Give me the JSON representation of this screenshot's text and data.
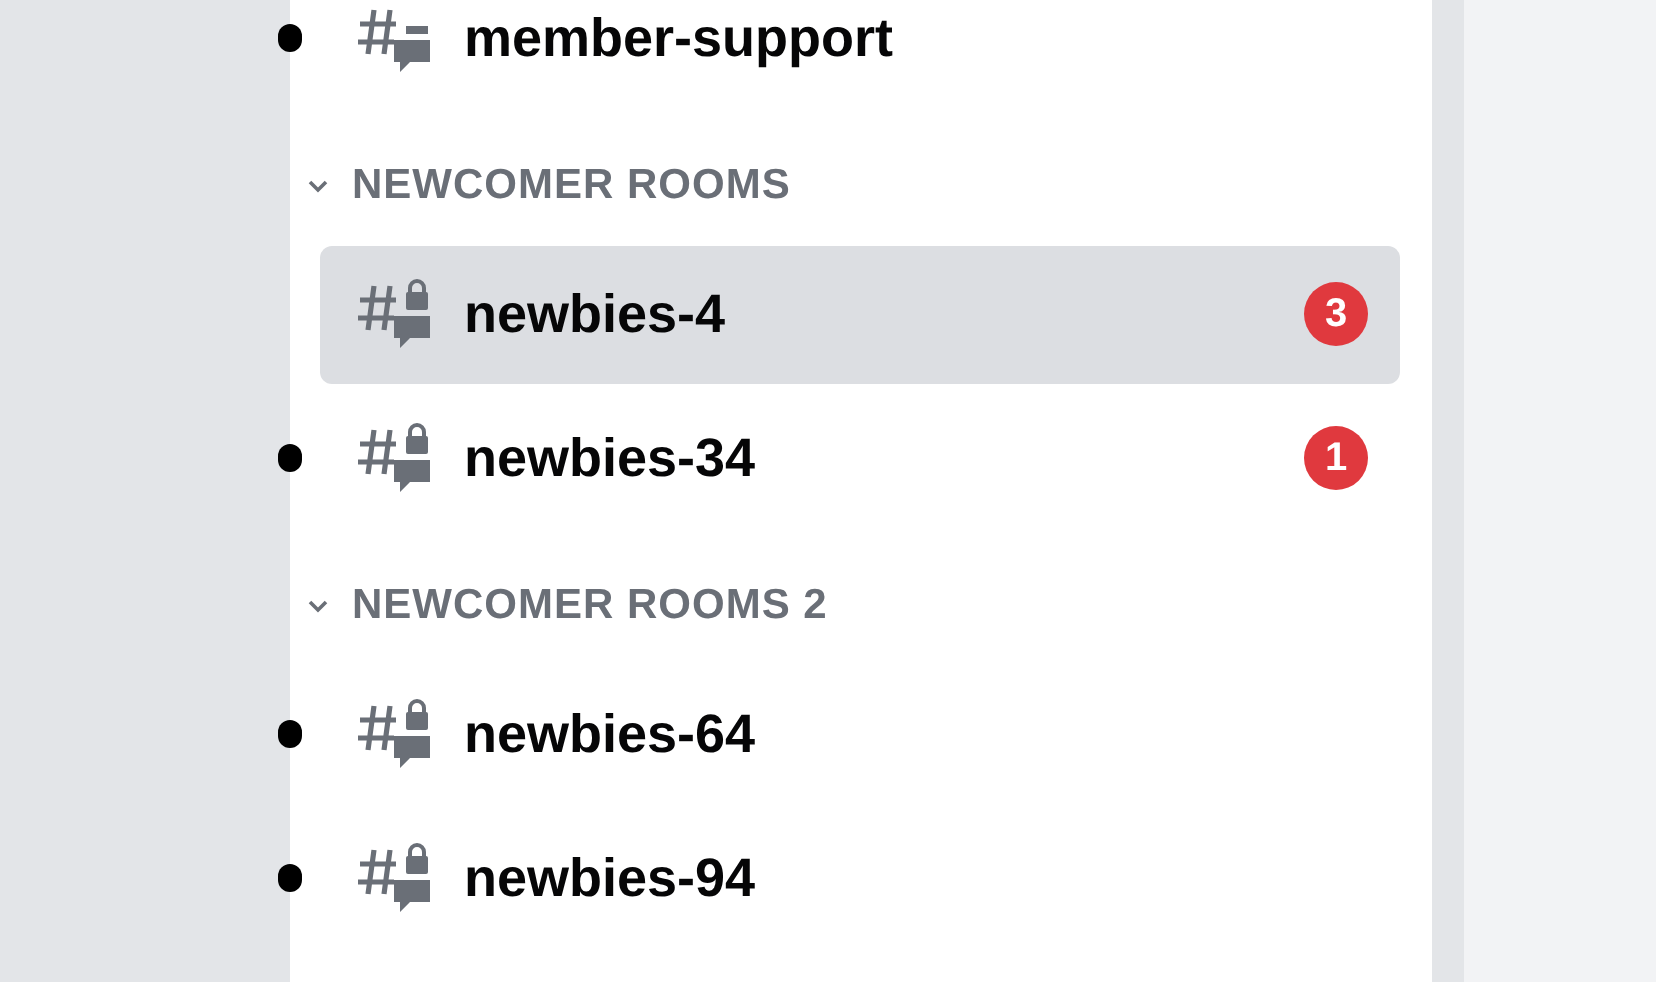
{
  "sidebar": {
    "items": [
      {
        "kind": "channel",
        "name": "member-support",
        "locked": false,
        "unread": true,
        "selected": false
      },
      {
        "kind": "category",
        "label": "NEWCOMER ROOMS",
        "expanded": true,
        "children": [
          {
            "kind": "channel",
            "name": "newbies-4",
            "locked": true,
            "unread": false,
            "selected": true,
            "mentions": "3"
          },
          {
            "kind": "channel",
            "name": "newbies-34",
            "locked": true,
            "unread": true,
            "selected": false,
            "mentions": "1"
          }
        ]
      },
      {
        "kind": "category",
        "label": "NEWCOMER ROOMS 2",
        "expanded": true,
        "children": [
          {
            "kind": "channel",
            "name": "newbies-64",
            "locked": true,
            "unread": true,
            "selected": false
          },
          {
            "kind": "channel",
            "name": "newbies-94",
            "locked": true,
            "unread": true,
            "selected": false
          }
        ]
      }
    ]
  }
}
